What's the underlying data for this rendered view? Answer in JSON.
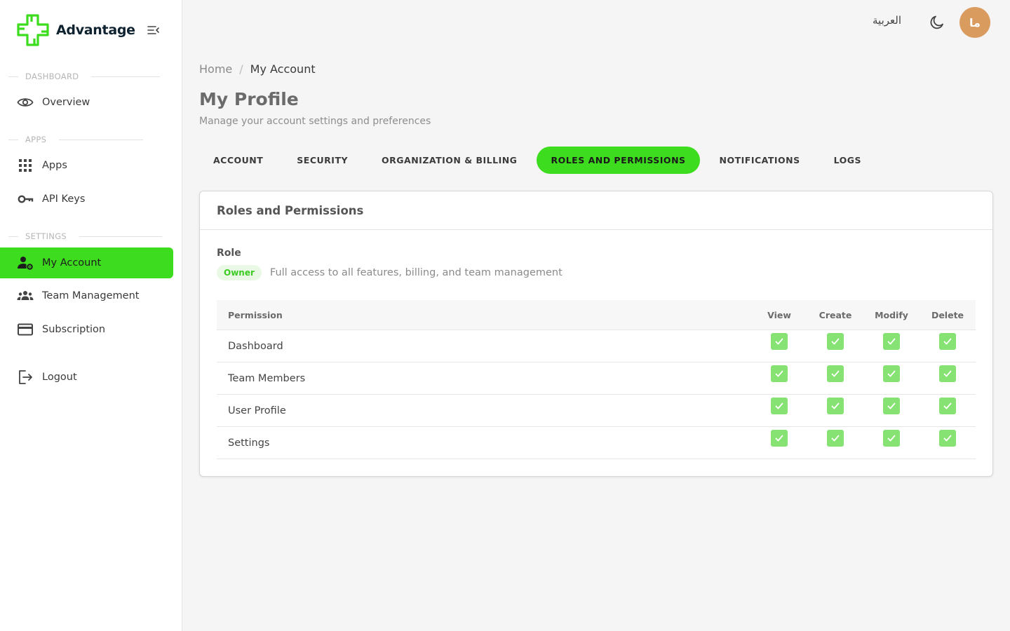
{
  "app": {
    "name": "Advantage"
  },
  "sidebar": {
    "sections": [
      {
        "label": "DASHBOARD"
      },
      {
        "label": "APPS"
      },
      {
        "label": "SETTINGS"
      }
    ],
    "items": [
      {
        "label": "Overview",
        "icon": "eye-icon"
      },
      {
        "label": "Apps",
        "icon": "grid-icon"
      },
      {
        "label": "API Keys",
        "icon": "key-icon"
      },
      {
        "label": "My Account",
        "icon": "user-settings-icon",
        "active": true
      },
      {
        "label": "Team Management",
        "icon": "team-icon"
      },
      {
        "label": "Subscription",
        "icon": "credit-card-icon"
      },
      {
        "label": "Logout",
        "icon": "logout-icon"
      }
    ]
  },
  "topbar": {
    "language": "العربية",
    "avatar_initials": "ما",
    "avatar_color": "#d99b5e"
  },
  "breadcrumb": {
    "home": "Home",
    "separator": "/",
    "current": "My Account"
  },
  "page": {
    "title": "My Profile",
    "subtitle": "Manage your account settings and preferences"
  },
  "tabs": [
    {
      "label": "ACCOUNT"
    },
    {
      "label": "SECURITY"
    },
    {
      "label": "ORGANIZATION & BILLING"
    },
    {
      "label": "ROLES AND PERMISSIONS",
      "active": true
    },
    {
      "label": "NOTIFICATIONS"
    },
    {
      "label": "LOGS"
    }
  ],
  "roles_card": {
    "title": "Roles and Permissions",
    "role_label": "Role",
    "role_badge": "Owner",
    "role_description": "Full access to all features, billing, and team management",
    "columns": [
      "Permission",
      "View",
      "Create",
      "Modify",
      "Delete"
    ],
    "rows": [
      {
        "name": "Dashboard",
        "view": true,
        "create": true,
        "modify": true,
        "delete": true
      },
      {
        "name": "Team Members",
        "view": true,
        "create": true,
        "modify": true,
        "delete": true
      },
      {
        "name": "User Profile",
        "view": true,
        "create": true,
        "modify": true,
        "delete": true
      },
      {
        "name": "Settings",
        "view": true,
        "create": true,
        "modify": true,
        "delete": true
      }
    ]
  },
  "colors": {
    "accent": "#3ddc1e",
    "check": "#86e272",
    "badge_bg": "#eaf9e6",
    "badge_text": "#3ccb23"
  }
}
